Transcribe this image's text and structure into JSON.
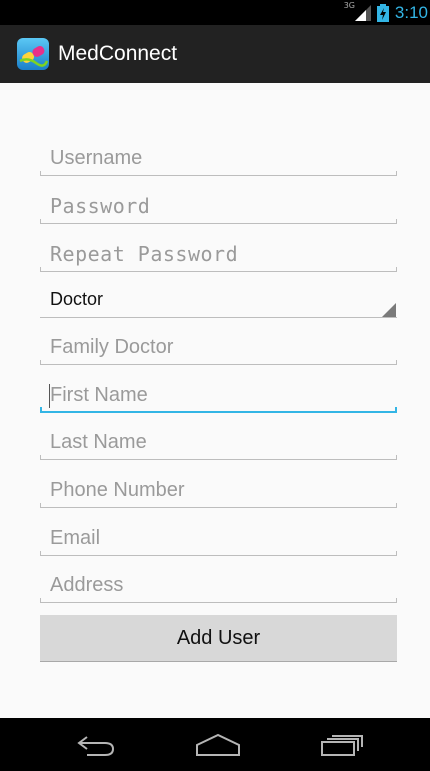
{
  "status_bar": {
    "network": "3G",
    "time": "3:10"
  },
  "action_bar": {
    "title": "MedConnect",
    "icon": "medconnect-app-icon"
  },
  "form": {
    "username": {
      "placeholder": "Username"
    },
    "password": {
      "placeholder": "Password"
    },
    "repeat_password": {
      "placeholder": "Repeat Password"
    },
    "role": {
      "selected": "Doctor"
    },
    "family_doctor": {
      "placeholder": "Family Doctor"
    },
    "first_name": {
      "placeholder": "First Name"
    },
    "last_name": {
      "placeholder": "Last Name"
    },
    "phone_number": {
      "placeholder": "Phone Number"
    },
    "email": {
      "placeholder": "Email"
    },
    "address": {
      "placeholder": "Address"
    },
    "submit_label": "Add User"
  },
  "nav_bar": {
    "back": "back-icon",
    "home": "home-icon",
    "recents": "recents-icon"
  },
  "colors": {
    "accent": "#33b5e5",
    "action_bar": "#222222",
    "background": "#fafafa"
  }
}
